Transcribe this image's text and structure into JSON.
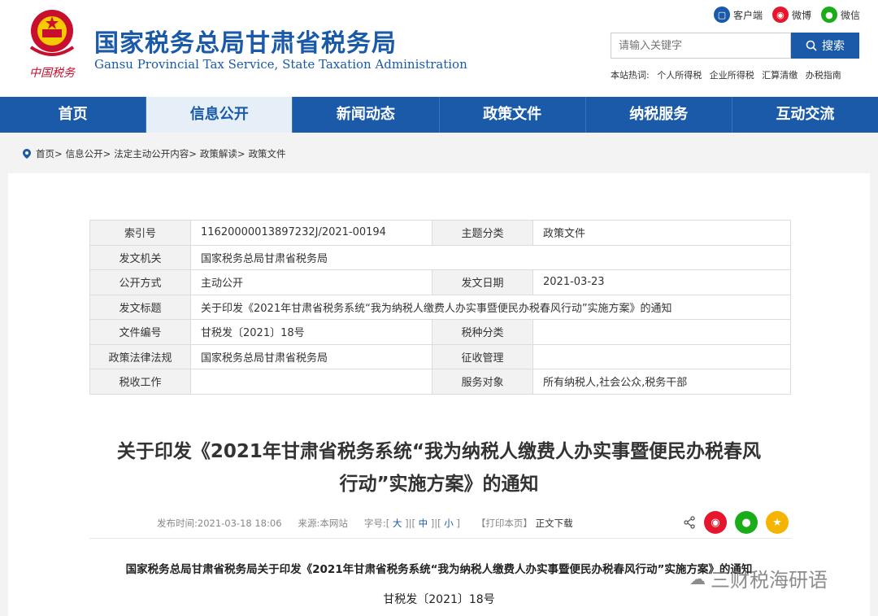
{
  "header": {
    "emblem_text": "中国税务",
    "title_cn": "国家税务总局甘肃省税务局",
    "title_en": "Gansu Provincial Tax Service, State Taxation Administration",
    "top_links": [
      "客户端",
      "微博",
      "微信"
    ],
    "search_placeholder": "请输入关键字",
    "search_button": "搜索",
    "hot_label": "本站热词:",
    "hot_words": [
      "个人所得税",
      "企业所得税",
      "汇算清缴",
      "办税指南"
    ]
  },
  "nav": {
    "items": [
      "首页",
      "信息公开",
      "新闻动态",
      "政策文件",
      "纳税服务",
      "互动交流"
    ],
    "active_index": 1
  },
  "breadcrumb": [
    "首页>",
    "信息公开>",
    "法定主动公开内容>",
    "政策解读>",
    "政策文件"
  ],
  "meta": {
    "rows": [
      {
        "l1": "索引号",
        "v1": "11620000013897232J/2021-00194",
        "l2": "主题分类",
        "v2": "政策文件"
      },
      {
        "l1": "发文机关",
        "v1": "国家税务总局甘肃省税务局"
      },
      {
        "l1": "公开方式",
        "v1": "主动公开",
        "l2": "发文日期",
        "v2": "2021-03-23"
      },
      {
        "l1": "发文标题",
        "v1": "关于印发《2021年甘肃省税务系统“我为纳税人缴费人办实事暨便民办税春风行动”实施方案》的通知"
      },
      {
        "l1": "文件编号",
        "v1": "甘税发〔2021〕18号",
        "l2": "税种分类",
        "v2": ""
      },
      {
        "l1": "政策法律法规",
        "v1": "国家税务总局甘肃省税务局",
        "l2": "征收管理",
        "v2": ""
      },
      {
        "l1": "税收工作",
        "v1": "",
        "l2": "服务对象",
        "v2": "所有纳税人,社会公众,税务干部"
      }
    ]
  },
  "article": {
    "title_line1": "关于印发《2021年甘肃省税务系统“我为纳税人缴费人办实事暨便民办税春风",
    "title_line2": "行动”实施方案》的通知",
    "publish_label": "发布时间:",
    "publish_time": "2021-03-18 18:06",
    "source_label": "来源:",
    "source": "本网站",
    "font_label": "字号:",
    "font_large": "大",
    "font_medium": "中",
    "font_small": "小",
    "print": "【打印本页】",
    "download": "正文下载",
    "body_line1": "国家税务总局甘肃省税务局关于印发《2021年甘肃省税务系统“我为纳税人缴费人办实事暨便民办税春风行动”实施方案》的通知",
    "body_line2": "甘税发〔2021〕18号"
  },
  "watermark": "三财税海研语",
  "colors": {
    "brand": "#1a5aa8",
    "weibo": "#e6162d",
    "wechat": "#1aad19",
    "fav": "#f5b400"
  }
}
